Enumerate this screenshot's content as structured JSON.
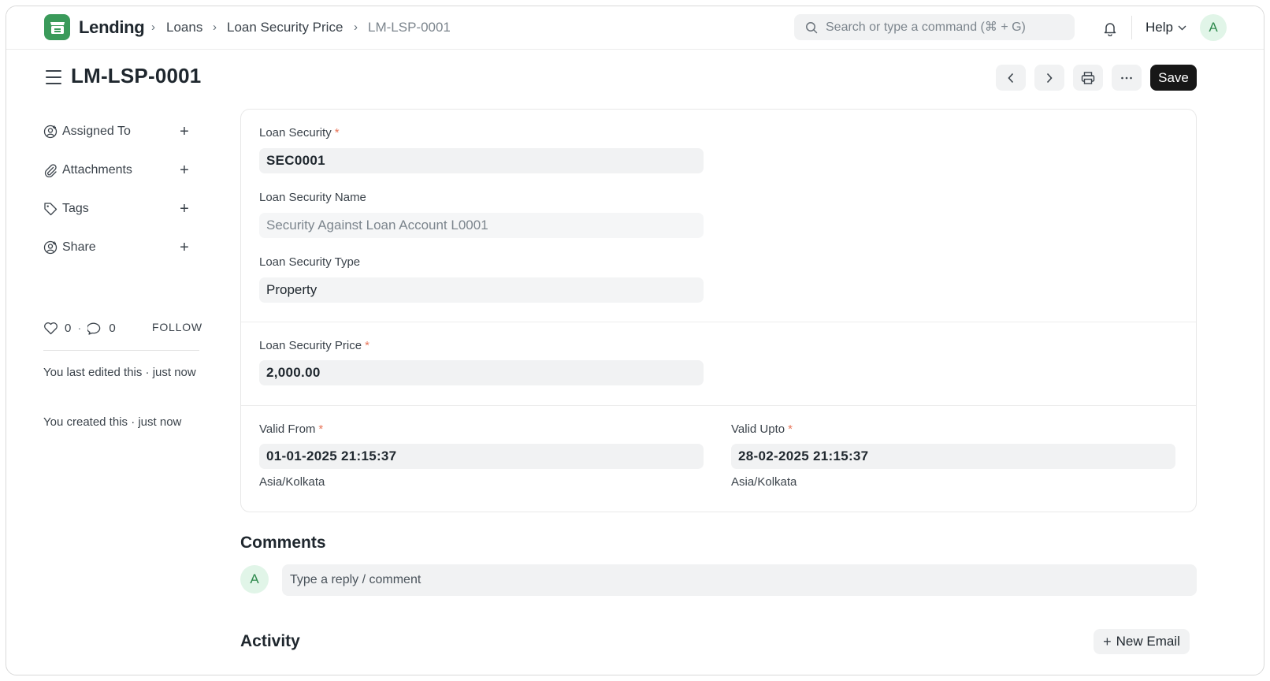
{
  "app": {
    "name": "Lending"
  },
  "breadcrumbs": {
    "item1": "Loans",
    "item2": "Loan Security Price",
    "current": "LM-LSP-0001"
  },
  "search": {
    "placeholder": "Search or type a command (⌘ + G)"
  },
  "user": {
    "initial": "A"
  },
  "help": {
    "label": "Help"
  },
  "page": {
    "title": "LM-LSP-0001",
    "save_label": "Save"
  },
  "sidebar": {
    "items": [
      {
        "label": "Assigned To",
        "icon": "assign-user-icon"
      },
      {
        "label": "Attachments",
        "icon": "paperclip-icon"
      },
      {
        "label": "Tags",
        "icon": "tag-icon"
      },
      {
        "label": "Share",
        "icon": "share-user-icon"
      }
    ],
    "likes": "0",
    "comments_count": "0",
    "separator": "·",
    "follow_label": "FOLLOW",
    "last_edited": "You last edited this · just now",
    "created": "You created this · just now"
  },
  "form": {
    "loan_security": {
      "label": "Loan Security",
      "value": "SEC0001"
    },
    "loan_security_name": {
      "label": "Loan Security Name",
      "value": "Security Against Loan Account L0001"
    },
    "loan_security_type": {
      "label": "Loan Security Type",
      "value": "Property"
    },
    "loan_security_price": {
      "label": "Loan Security Price",
      "value": "2,000.00"
    },
    "valid_from": {
      "label": "Valid From",
      "value": "01-01-2025 21:15:37",
      "timezone": "Asia/Kolkata"
    },
    "valid_upto": {
      "label": "Valid Upto",
      "value": "28-02-2025 21:15:37",
      "timezone": "Asia/Kolkata"
    },
    "required_mark": "*"
  },
  "comments": {
    "heading": "Comments",
    "placeholder": "Type a reply / comment"
  },
  "activity": {
    "heading": "Activity",
    "new_email_label": "New Email"
  },
  "colors": {
    "accent": "#3a9a5a",
    "save_bg": "#171717",
    "required": "#e8765a",
    "field_bg": "#f1f2f3"
  }
}
